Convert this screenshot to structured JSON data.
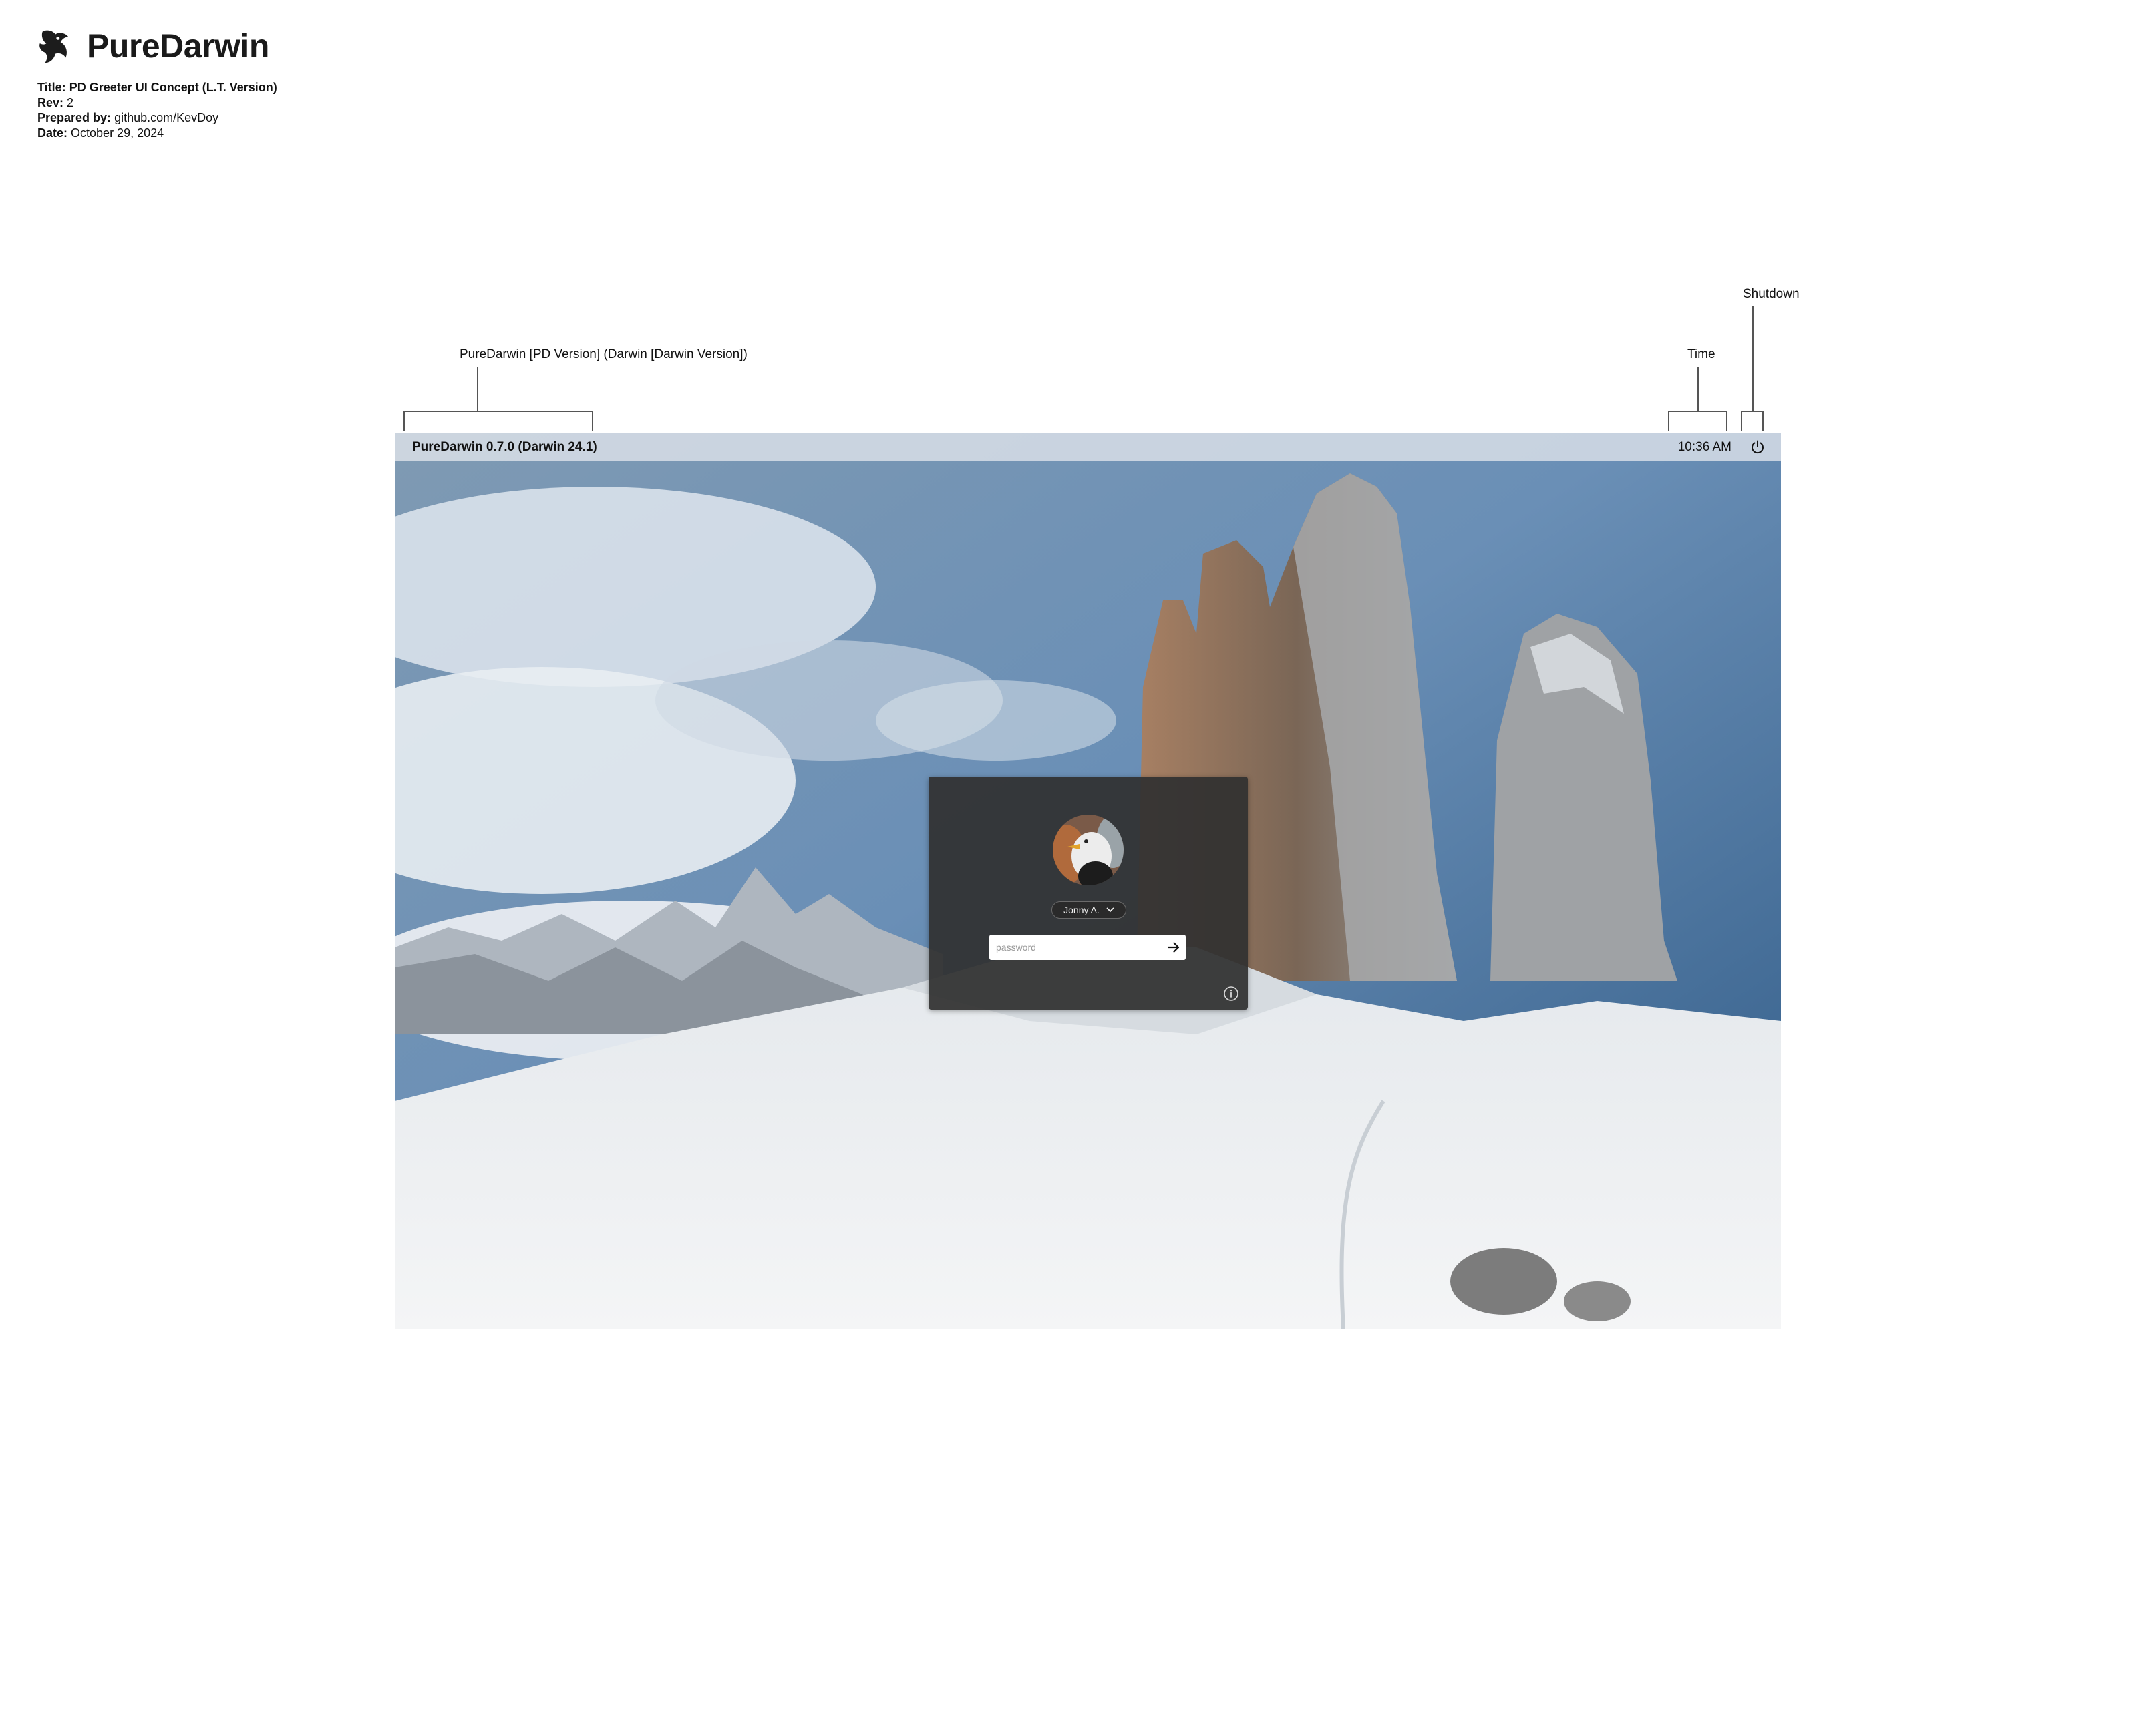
{
  "brand": {
    "name": "PureDarwin",
    "logo_icon": "puredarwin-dragon-logo"
  },
  "doc_info": {
    "title_label": "Title:",
    "title_value": "PD Greeter UI Concept (L.T. Version)",
    "rev_label": "Rev:",
    "rev_value": "2",
    "prepared_label": "Prepared by:",
    "prepared_value": "github.com/KevDoy",
    "date_label": "Date:",
    "date_value": "October 29, 2024"
  },
  "annotations": {
    "version": "PureDarwin  [PD Version] (Darwin [Darwin Version])",
    "time": "Time",
    "shutdown": "Shutdown"
  },
  "menubar": {
    "version_text": "PureDarwin 0.7.0 (Darwin 24.1)",
    "time_text": "10:36 AM",
    "shutdown_icon": "power-icon"
  },
  "login": {
    "user_name": "Jonny A.",
    "dropdown_icon": "chevron-down-icon",
    "password_placeholder": "password",
    "password_value": "",
    "submit_icon": "arrow-right-icon",
    "info_icon": "info-icon"
  },
  "colors": {
    "menubar_bg": "#e1e6ec",
    "panel_bg": "#303030",
    "text": "#111111"
  }
}
